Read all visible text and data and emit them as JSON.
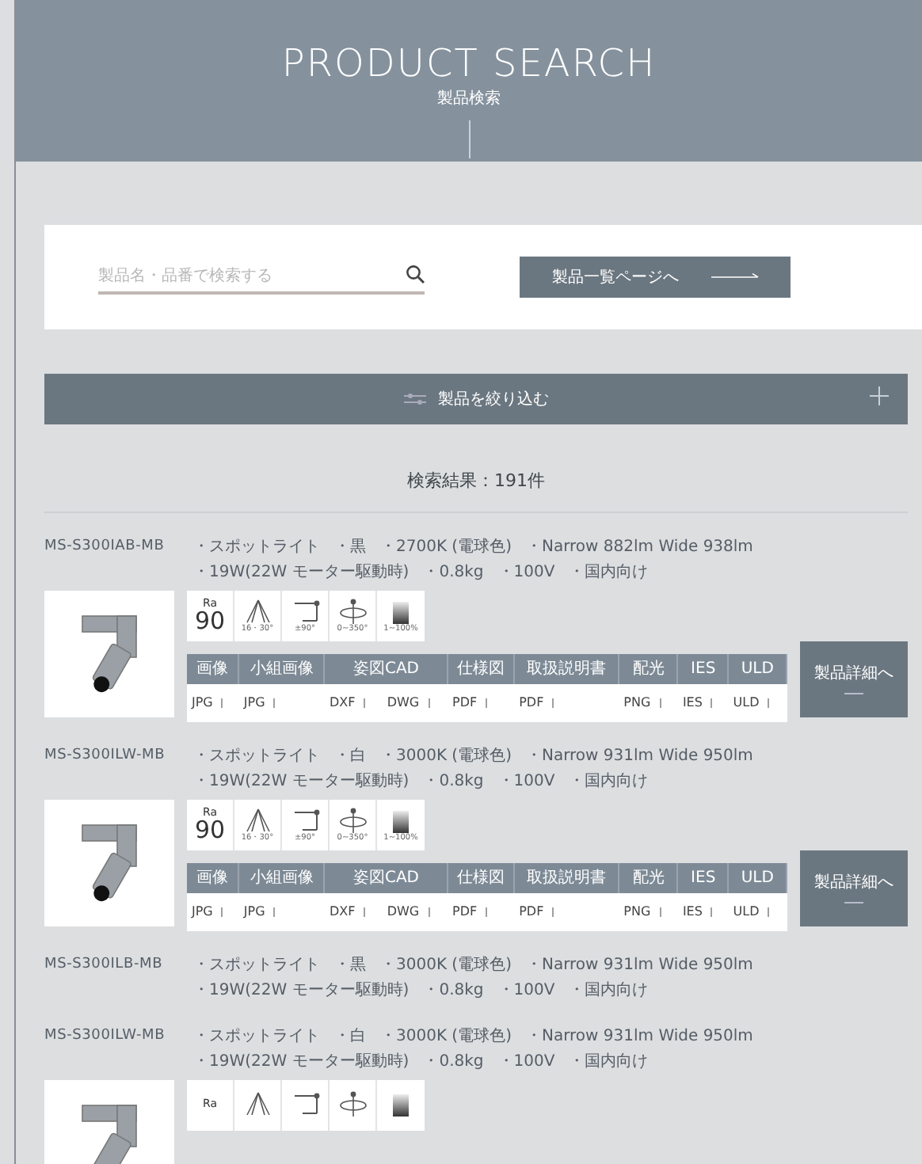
{
  "header": {
    "title": "PRODUCT SEARCH",
    "subtitle": "製品検索"
  },
  "search": {
    "placeholder": "製品名・品番で検索する",
    "list_button": "製品一覧ページへ"
  },
  "filter_bar": {
    "label": "製品を絞り込む"
  },
  "result_count": "検索結果：191件",
  "products": [
    {
      "model": "MS-S300IAB-MB",
      "tags": [
        "・スポットライト",
        "・黒",
        "・2700K (電球色)",
        "・Narrow 882lm  Wide 938lm",
        "・19W(22W モーター駆動時)",
        "・0.8kg",
        "・100V",
        "・国内向け"
      ],
      "specs": [
        {
          "kind": "ra",
          "label": "Ra",
          "value": "90"
        },
        {
          "kind": "beam",
          "caption": "16・30°"
        },
        {
          "kind": "tilt",
          "caption": "±90°"
        },
        {
          "kind": "rotate",
          "caption": "0~350°"
        },
        {
          "kind": "dim",
          "caption": "1~100%"
        }
      ],
      "downloads": [
        {
          "heading": "画像",
          "files": [
            "JPG"
          ]
        },
        {
          "heading": "小組画像",
          "files": [
            "JPG"
          ]
        },
        {
          "heading": "姿図CAD",
          "files": [
            "DXF",
            "DWG"
          ]
        },
        {
          "heading": "仕様図",
          "files": [
            "PDF"
          ]
        },
        {
          "heading": "取扱説明書",
          "files": [
            "PDF"
          ]
        },
        {
          "heading": "配光",
          "files": [
            "PNG"
          ]
        },
        {
          "heading": "IES",
          "files": [
            "IES"
          ]
        },
        {
          "heading": "ULD",
          "files": [
            "ULD"
          ]
        }
      ],
      "detail_button": "製品詳細へ"
    },
    {
      "model": "MS-S300ILW-MB",
      "tags": [
        "・スポットライト",
        "・白",
        "・3000K (電球色)",
        "・Narrow 931lm  Wide 950lm",
        "・19W(22W モーター駆動時)",
        "・0.8kg",
        "・100V",
        "・国内向け"
      ],
      "specs": [
        {
          "kind": "ra",
          "label": "Ra",
          "value": "90"
        },
        {
          "kind": "beam",
          "caption": "16・30°"
        },
        {
          "kind": "tilt",
          "caption": "±90°"
        },
        {
          "kind": "rotate",
          "caption": "0~350°"
        },
        {
          "kind": "dim",
          "caption": "1~100%"
        }
      ],
      "downloads": [
        {
          "heading": "画像",
          "files": [
            "JPG"
          ]
        },
        {
          "heading": "小組画像",
          "files": [
            "JPG"
          ]
        },
        {
          "heading": "姿図CAD",
          "files": [
            "DXF",
            "DWG"
          ]
        },
        {
          "heading": "仕様図",
          "files": [
            "PDF"
          ]
        },
        {
          "heading": "取扱説明書",
          "files": [
            "PDF"
          ]
        },
        {
          "heading": "配光",
          "files": [
            "PNG"
          ]
        },
        {
          "heading": "IES",
          "files": [
            "IES"
          ]
        },
        {
          "heading": "ULD",
          "files": [
            "ULD"
          ]
        }
      ],
      "detail_button": "製品詳細へ"
    },
    {
      "model": "MS-S300ILB-MB",
      "tags": [
        "・スポットライト",
        "・黒",
        "・3000K (電球色)",
        "・Narrow 931lm  Wide 950lm",
        "・19W(22W モーター駆動時)",
        "・0.8kg",
        "・100V",
        "・国内向け"
      ]
    },
    {
      "model": "MS-S300ILW-MB",
      "tags": [
        "・スポットライト",
        "・白",
        "・3000K (電球色)",
        "・Narrow 931lm  Wide 950lm",
        "・19W(22W モーター駆動時)",
        "・0.8kg",
        "・100V",
        "・国内向け"
      ],
      "specs": [
        {
          "kind": "ra",
          "label": "Ra"
        },
        {
          "kind": "beam"
        },
        {
          "kind": "tilt"
        },
        {
          "kind": "rotate"
        },
        {
          "kind": "dim"
        }
      ]
    }
  ]
}
